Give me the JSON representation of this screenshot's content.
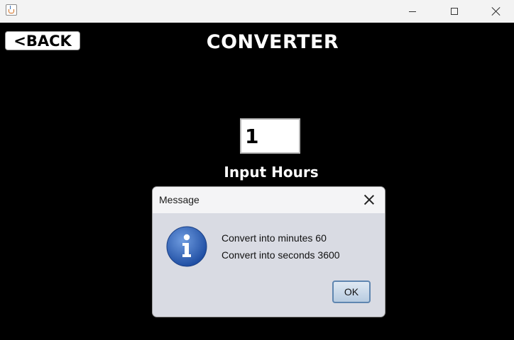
{
  "window": {
    "controls": {
      "minimize_icon": "minimize-icon",
      "maximize_icon": "maximize-icon",
      "close_icon": "close-icon"
    },
    "app_icon": "java-icon"
  },
  "app": {
    "back_label": "<BACK",
    "title": "CONVERTER",
    "hours_value": "1",
    "input_label": "Input Hours"
  },
  "dialog": {
    "title": "Message",
    "icon": "info-icon",
    "line1": "Convert into minutes 60",
    "line2": "Convert into seconds 3600",
    "ok_label": "OK"
  },
  "colors": {
    "background": "#000000",
    "dialog_body": "#d9dbe3",
    "info_blue": "#2f62b4"
  }
}
